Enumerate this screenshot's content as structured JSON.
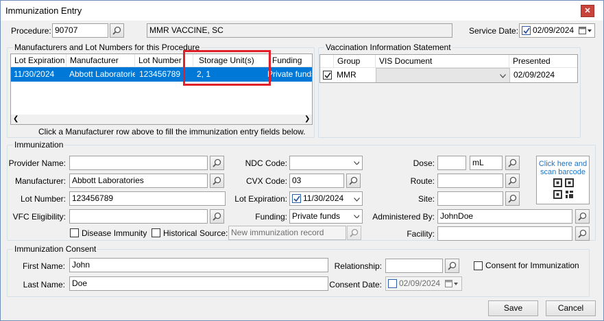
{
  "window": {
    "title": "Immunization Entry",
    "close_label": "✕"
  },
  "procedure": {
    "label": "Procedure:",
    "code": "90707",
    "description": "MMR VACCINE, SC"
  },
  "service_date": {
    "label": "Service Date:",
    "value": "02/09/2024"
  },
  "manufacturers": {
    "title": "Manufacturers and Lot Numbers for this Procedure",
    "columns": [
      "Lot Expiration",
      "Manufacturer",
      "Lot Number",
      "Storage Unit(s)",
      "Funding"
    ],
    "rows": [
      {
        "lot_expiration": "11/30/2024",
        "manufacturer": "Abbott Laboratories",
        "lot_number": "123456789",
        "storage_units": "2, 1",
        "funding": "Private funds"
      }
    ],
    "hint": "Click a Manufacturer row above to fill the immunization entry fields below."
  },
  "vis": {
    "title": "Vaccination Information Statement",
    "columns": [
      "Group",
      "VIS Document",
      "Presented"
    ],
    "rows": [
      {
        "group": "MMR",
        "document": "",
        "presented": "02/09/2024"
      }
    ]
  },
  "immunization": {
    "title": "Immunization",
    "provider_name": {
      "label": "Provider Name:",
      "value": ""
    },
    "manufacturer": {
      "label": "Manufacturer:",
      "value": "Abbott Laboratories"
    },
    "lot_number": {
      "label": "Lot Number:",
      "value": "123456789"
    },
    "vfc_eligibility": {
      "label": "VFC Eligibility:",
      "value": ""
    },
    "ndc_code": {
      "label": "NDC Code:",
      "value": ""
    },
    "cvx_code": {
      "label": "CVX Code:",
      "value": "03"
    },
    "lot_expiration": {
      "label": "Lot Expiration:",
      "value": "11/30/2024"
    },
    "funding": {
      "label": "Funding:",
      "value": "Private funds"
    },
    "dose": {
      "label": "Dose:",
      "value": "",
      "unit": "mL"
    },
    "route": {
      "label": "Route:",
      "value": ""
    },
    "site": {
      "label": "Site:",
      "value": ""
    },
    "administered_by": {
      "label": "Administered By:",
      "value": "JohnDoe"
    },
    "facility": {
      "label": "Facility:",
      "value": ""
    },
    "disease_immunity_label": "Disease Immunity",
    "historical_label": "Historical",
    "source": {
      "label": "Source:",
      "value": "New immunization record"
    },
    "barcode_text": "Click here and scan barcode"
  },
  "consent": {
    "title": "Immunization Consent",
    "first_name": {
      "label": "First Name:",
      "value": "John"
    },
    "last_name": {
      "label": "Last Name:",
      "value": "Doe"
    },
    "relationship": {
      "label": "Relationship:",
      "value": ""
    },
    "consent_date": {
      "label": "Consent Date:",
      "value": "02/09/2024"
    },
    "consent_for_immunization_label": "Consent for Immunization"
  },
  "buttons": {
    "save": "Save",
    "cancel": "Cancel"
  },
  "colors": {
    "selection": "#0078d7",
    "highlight_box": "#e2202b",
    "window_border": "#6d8fb8"
  }
}
